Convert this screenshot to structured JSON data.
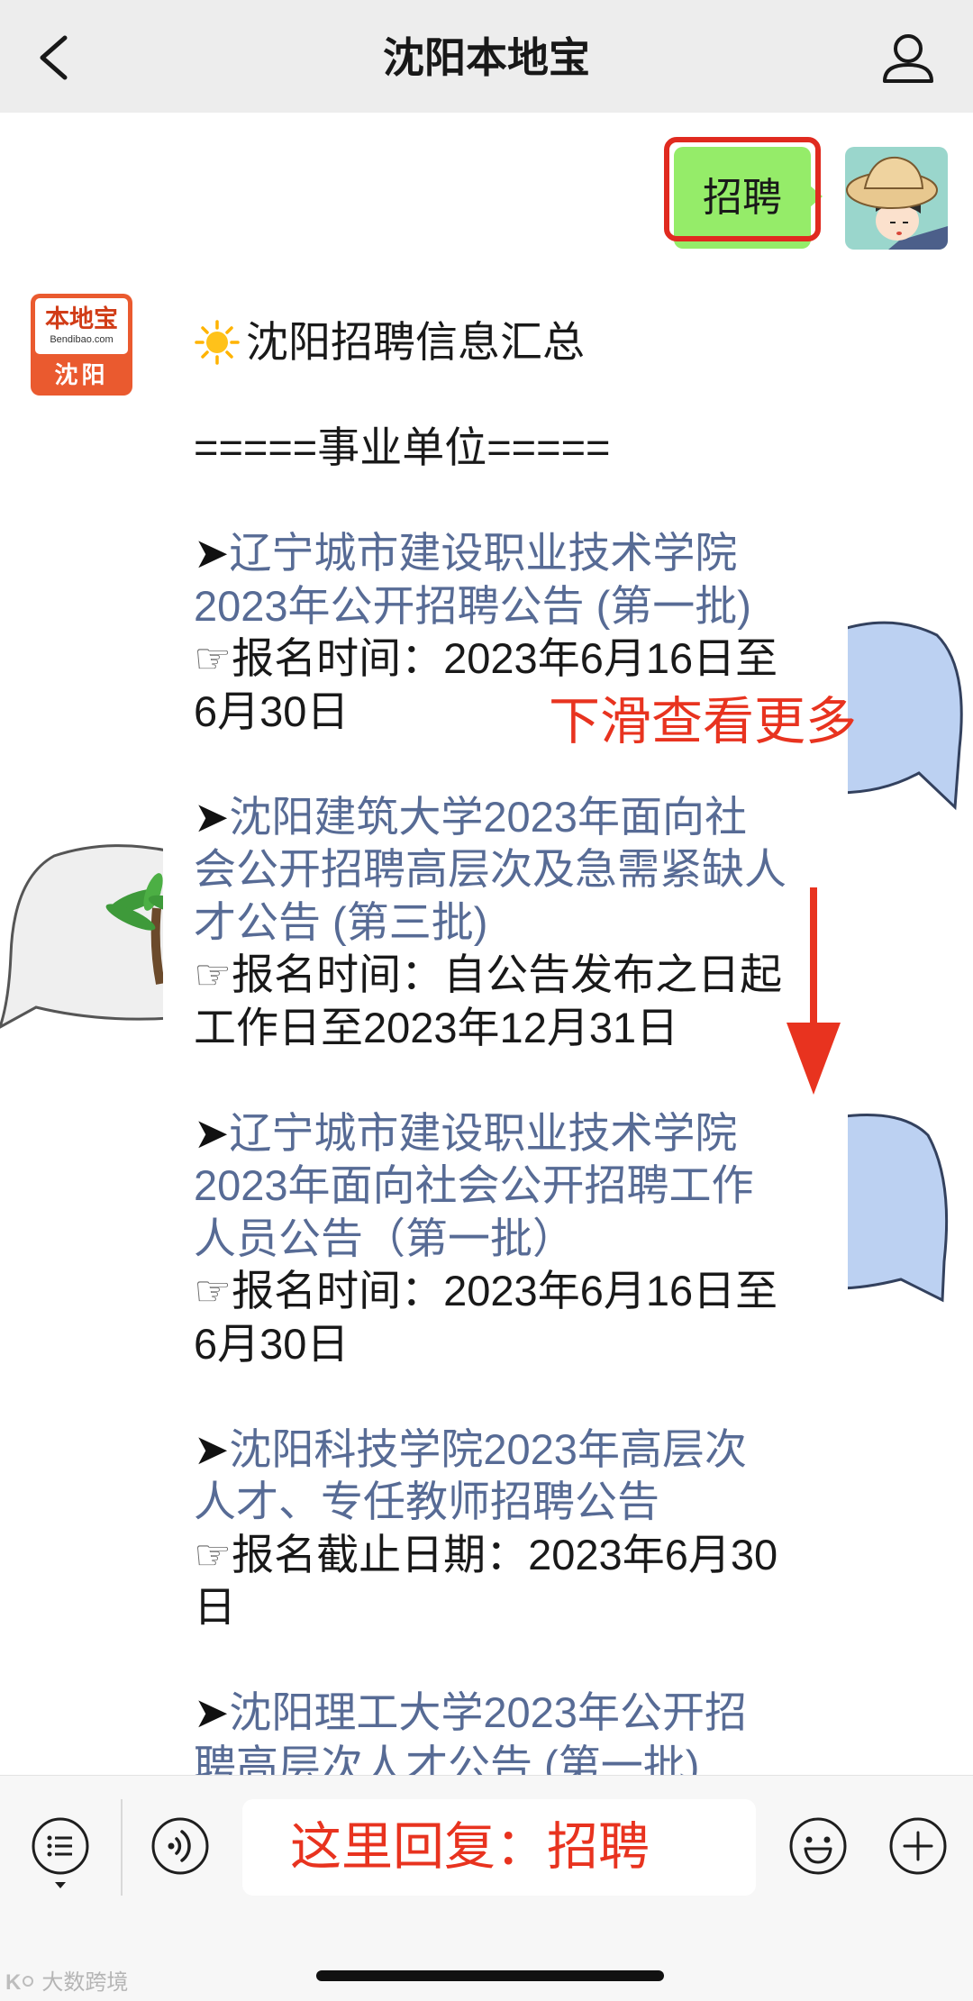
{
  "nav": {
    "title": "沈阳本地宝",
    "back_icon": "chevron-left-icon",
    "profile_icon": "user-icon"
  },
  "user_message": {
    "text": "招聘",
    "bubble_color": "#95ec69",
    "highlight_color": "#e02a1f",
    "avatar": "cartoon-girl-avatar"
  },
  "bot_avatar": {
    "brand": "本地宝",
    "domain": "Bendibao.com",
    "city": "沈阳",
    "color": "#ea5a2f"
  },
  "message": {
    "title_icon": "sun-icon",
    "title": "沈阳招聘信息汇总",
    "section_header": "=====事业单位=====",
    "bullet": "➤",
    "info_marker": "☞",
    "link_color": "#576b95",
    "items": [
      {
        "title_lines": [
          "辽宁城市建设职业技术学院",
          "2023年公开招聘公告 (第一批)"
        ],
        "info_lines": [
          "报名时间：2023年6月16日至",
          "6月30日"
        ]
      },
      {
        "title_lines": [
          "沈阳建筑大学2023年面向社",
          "会公开招聘高层次及急需紧缺人",
          "才公告 (第三批)"
        ],
        "info_lines": [
          "报名时间：自公告发布之日起",
          "工作日至2023年12月31日"
        ]
      },
      {
        "title_lines": [
          "辽宁城市建设职业技术学院",
          "2023年面向社会公开招聘工作",
          "人员公告（第一批）"
        ],
        "info_lines": [
          "报名时间：2023年6月16日至",
          "6月30日"
        ]
      },
      {
        "title_lines": [
          "沈阳科技学院2023年高层次",
          "人才、专任教师招聘公告"
        ],
        "info_lines": [
          "报名截止日期：2023年6月30",
          "日"
        ]
      },
      {
        "title_lines": [
          "沈阳理工大学2023年公开招",
          "聘高层次人才公告 (第一批)"
        ],
        "info_lines": []
      }
    ]
  },
  "annotations": {
    "scroll_hint": "下滑查看更多",
    "arrow_icon": "arrow-down-icon",
    "color": "#e8331f"
  },
  "input_bar": {
    "menu_icon": "menu-list-icon",
    "voice_icon": "voice-icon",
    "reply_hint": "这里回复：招聘",
    "emoji_icon": "emoji-icon",
    "plus_icon": "plus-icon"
  },
  "watermark": {
    "logo_text": "K",
    "text": "大数跨境"
  }
}
